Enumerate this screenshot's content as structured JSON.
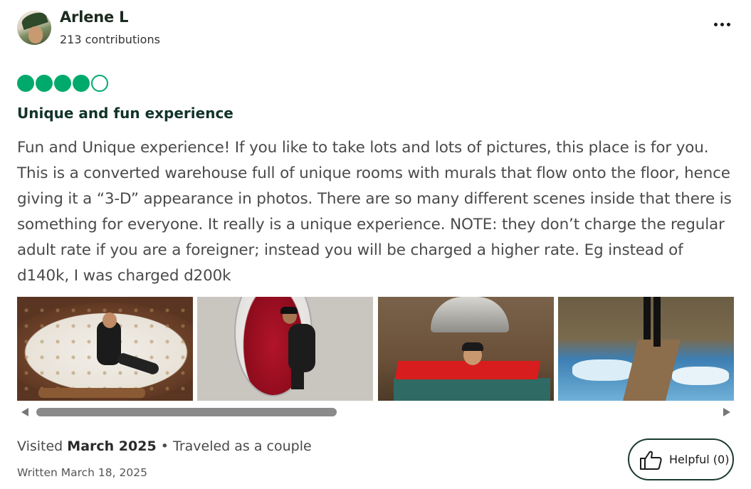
{
  "review": {
    "user_name": "Arlene L",
    "contributions": "213 contributions",
    "rating": {
      "value": 4,
      "max": 5
    },
    "title": "Unique and fun experience",
    "body": "Fun and Unique experience! If you like to take lots and lots of pictures, this place is for you. This is a converted warehouse full of unique rooms with murals that flow onto the floor, hence giving it a “3-D” appearance in photos. There are so many different scenes inside that there is something for everyone. It really is a unique experience. NOTE: they don’t charge the regular adult rate if you are a foreigner; instead you will be charged a higher rate. Eg instead of d140k, I was charged d200k",
    "visited_prefix": "Visited",
    "visited_date": "March 2025",
    "separator": "•",
    "trip_type": "Traveled as a couple",
    "written": "Written March 18, 2025",
    "helpful_label": "Helpful (0)"
  },
  "icons": {
    "more": "more-options-icon",
    "helpful": "thumbs-up-icon",
    "scroll_left": "chevron-left-icon",
    "scroll_right": "chevron-right-icon"
  },
  "colors": {
    "rating_bubble": "#00aa6c",
    "title": "#11332a",
    "helpful_border": "#1a3a30"
  },
  "photo_scroll": {
    "visible_fraction": 0.44,
    "position_fraction": 0.0
  }
}
